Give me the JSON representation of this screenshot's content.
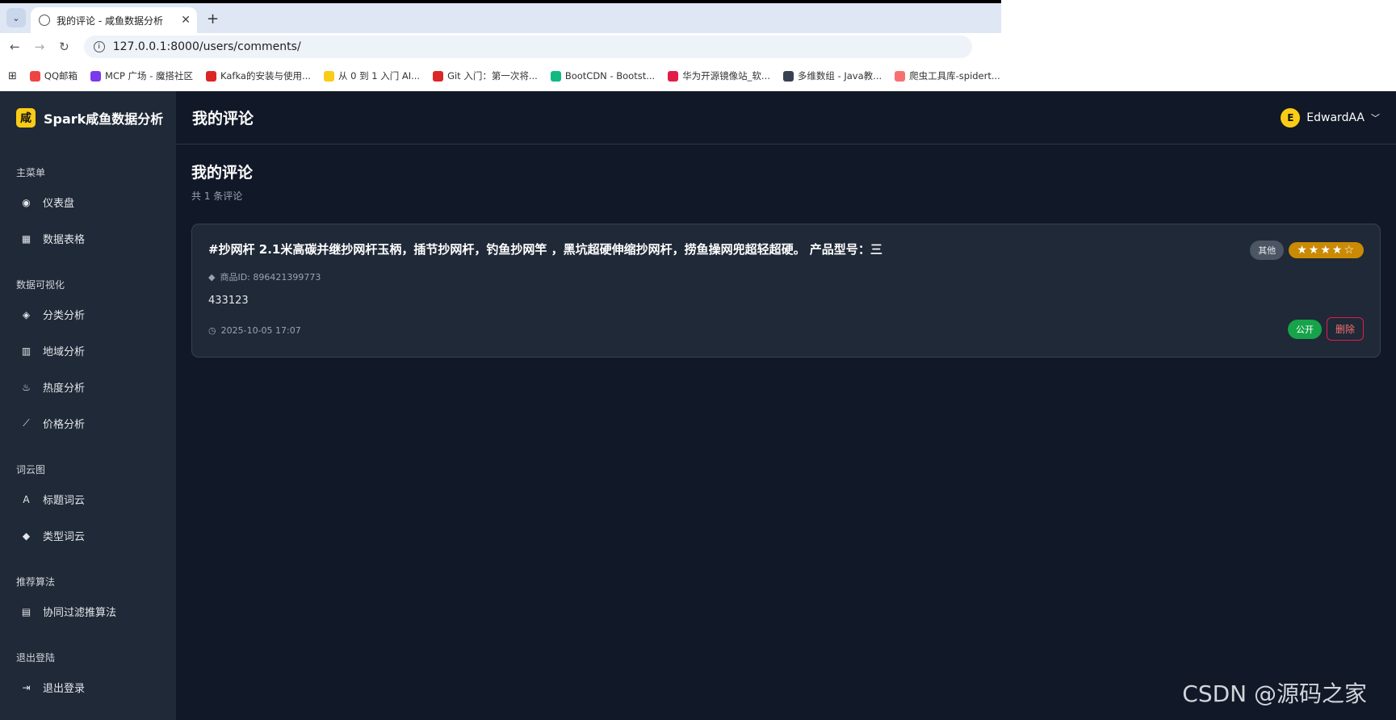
{
  "browser": {
    "tab_title": "我的评论 - 咸鱼数据分析",
    "url": "127.0.0.1:8000/users/comments/",
    "bookmarks": [
      {
        "label": "QQ邮箱",
        "color": "#ef4444"
      },
      {
        "label": "MCP 广场 - 魔搭社区",
        "color": "#7c3aed"
      },
      {
        "label": "Kafka的安装与使用...",
        "color": "#dc2626"
      },
      {
        "label": "从 0 到 1 入门 AI...",
        "color": "#facc15"
      },
      {
        "label": "Git 入门：第一次将...",
        "color": "#dc2626"
      },
      {
        "label": "BootCDN - Bootst...",
        "color": "#10b981"
      },
      {
        "label": "华为开源镜像站_软...",
        "color": "#e11d48"
      },
      {
        "label": "多维数组 - Java教...",
        "color": "#374151"
      },
      {
        "label": "爬虫工具库-spidert...",
        "color": "#f87171"
      }
    ]
  },
  "sidebar": {
    "logo_char": "咸",
    "brand": "Spark咸鱼数据分析",
    "sections": [
      {
        "title": "主菜单",
        "items": [
          {
            "label": "仪表盘",
            "icon": "◉",
            "name": "gauge-icon"
          },
          {
            "label": "数据表格",
            "icon": "▦",
            "name": "table-icon"
          }
        ]
      },
      {
        "title": "数据可视化",
        "items": [
          {
            "label": "分类分析",
            "icon": "◈",
            "name": "layers-icon"
          },
          {
            "label": "地域分析",
            "icon": "▥",
            "name": "city-icon"
          },
          {
            "label": "热度分析",
            "icon": "♨",
            "name": "fire-icon"
          },
          {
            "label": "价格分析",
            "icon": "⟋",
            "name": "line-chart-icon"
          }
        ]
      },
      {
        "title": "词云图",
        "items": [
          {
            "label": "标题词云",
            "icon": "A",
            "name": "font-icon"
          },
          {
            "label": "类型词云",
            "icon": "◆",
            "name": "tags-icon"
          }
        ]
      },
      {
        "title": "推荐算法",
        "items": [
          {
            "label": "协同过滤推算法",
            "icon": "▤",
            "name": "file-icon"
          }
        ]
      },
      {
        "title": "退出登陆",
        "items": [
          {
            "label": "退出登录",
            "icon": "⇥",
            "name": "logout-icon"
          }
        ]
      }
    ]
  },
  "header": {
    "title": "我的评论",
    "user_initial": "E",
    "username": "EdwardAA"
  },
  "main": {
    "heading": "我的评论",
    "count": "共 1 条评论",
    "comment": {
      "title": "#抄网杆 2.1米高碳并继抄网杆玉柄，插节抄网杆，钓鱼抄网竿 ，黑坑超硬伸缩抄网杆，捞鱼操网兜超轻超硬。 产品型号：三",
      "category": "其他",
      "rating": 4,
      "product_id": "商品ID: 896421399773",
      "text": "433123",
      "date": "2025-10-05 17:07",
      "visibility": "公开",
      "delete_label": "删除"
    }
  },
  "watermark": "CSDN @源码之家"
}
